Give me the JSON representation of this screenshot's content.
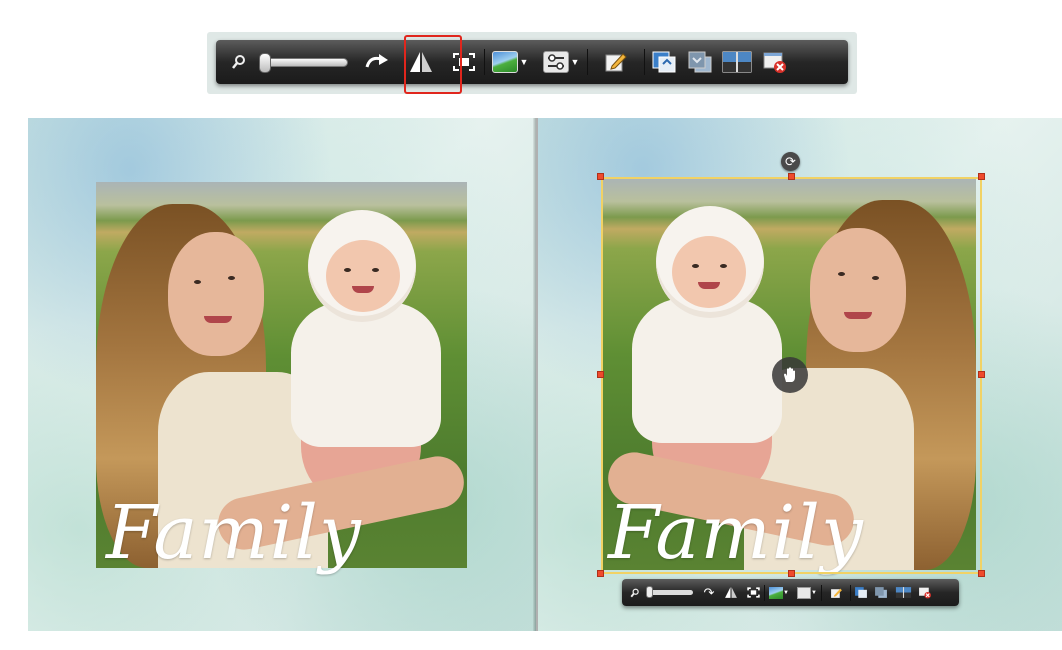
{
  "app": {
    "accent_highlight": "#e0261d",
    "selection_color": "#f1d265",
    "handle_color": "#ef4a2c"
  },
  "top_toolbar": {
    "tools": [
      {
        "name": "zoom-icon"
      },
      {
        "name": "zoom-slider",
        "value": 0
      },
      {
        "name": "rotate-icon"
      },
      {
        "name": "flip-icon",
        "highlighted": true
      },
      {
        "name": "fit-frame-icon"
      },
      {
        "name": "image-filter-icon",
        "has_dropdown": true
      },
      {
        "name": "adjust-settings-icon",
        "has_dropdown": true
      },
      {
        "name": "edit-icon"
      },
      {
        "name": "bring-forward-icon"
      },
      {
        "name": "send-backward-icon"
      },
      {
        "name": "background-icon"
      },
      {
        "name": "delete-icon"
      }
    ]
  },
  "album": {
    "left_page": {
      "caption": "Family"
    },
    "right_page": {
      "caption": "Family",
      "selected": true,
      "mirrored": true
    }
  }
}
